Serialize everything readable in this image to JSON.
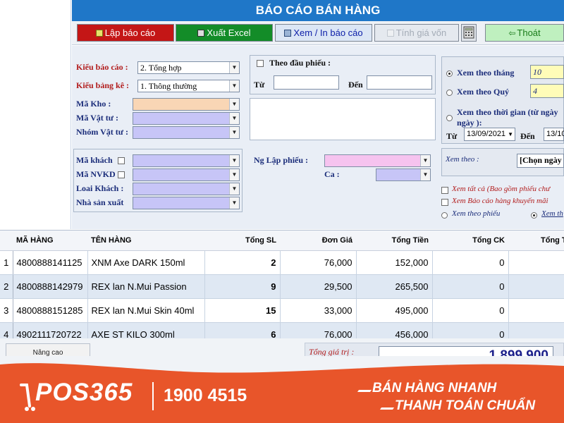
{
  "title": "BÁO CÁO BÁN HÀNG",
  "toolbar": {
    "report": "Lập báo cáo",
    "excel": "Xuất Excel",
    "view_print": "Xem / In báo cáo",
    "cost": "Tính giá vốn",
    "exit": "Thoát"
  },
  "filters": {
    "report_type_label": "Kiểu báo cáo :",
    "report_type_value": "2. Tổng hợp",
    "list_type_label": "Kiểu bảng kê :",
    "list_type_value": "1. Thông thường",
    "warehouse_label": "Mã Kho :",
    "material_label": "Mã Vật tư :",
    "material_group_label": "Nhóm Vật tư :",
    "customer_label": "Mã khách",
    "staff_label": "Mã NVKD",
    "customer_type_label": "Loai Khách :",
    "manufacturer_label": "Nhà sản xuất",
    "voucher_head_label": "Theo đầu phiếu :",
    "from_label": "Từ",
    "to_label": "Đến",
    "creator_label": "Ng Lập phiếu :",
    "shift_label": "Ca :"
  },
  "period": {
    "by_month_label": "Xem theo tháng",
    "month_value": "10",
    "by_quarter_label": "Xem theo Quý",
    "quarter_value": "4",
    "by_time_label": "Xem theo thời gian (từ ngày",
    "by_time_label2": "ngày ):",
    "from_label": "Từ",
    "from_date": "13/09/2021",
    "to_label": "Đến",
    "to_date": "13/10"
  },
  "view_by": {
    "label": "Xem theo :",
    "value": "[Chọn ngày"
  },
  "options": {
    "view_all": "Xem tất cả (Bao gồm phiếu chư",
    "promo": "Xem Báo cáo hàng khuyến mãi",
    "by_voucher": "Xem theo phiếu",
    "by_item": "Xem th"
  },
  "table": {
    "headers": [
      "MÃ HÀNG",
      "TÊN HÀNG",
      "Tổng SL",
      "Đơn Giá",
      "Tổng Tiền",
      "Tổng CK",
      "Tổng T"
    ],
    "rows": [
      {
        "no": "1",
        "code": "4800888141125",
        "name": "XNM Axe DARK 150ml",
        "qty": "2",
        "price": "76,000",
        "total": "152,000",
        "discount": "0"
      },
      {
        "no": "2",
        "code": "4800888142979",
        "name": "REX lan N.Mui Passion",
        "qty": "9",
        "price": "29,500",
        "total": "265,500",
        "discount": "0"
      },
      {
        "no": "3",
        "code": "4800888151285",
        "name": "REX lan N.Mui Skin 40ml",
        "qty": "15",
        "price": "33,000",
        "total": "495,000",
        "discount": "0"
      },
      {
        "no": "4",
        "code": "4902111720722",
        "name": "AXE ST KILO 300ml",
        "qty": "6",
        "price": "76,000",
        "total": "456,000",
        "discount": "0"
      }
    ]
  },
  "footer": {
    "advanced": "Nâng cao",
    "total_label": "Tổng giá trị :",
    "total_value": "1.899.900"
  },
  "banner": {
    "brand": "POS365",
    "hotline": "1900 4515",
    "slogan1": "BÁN HÀNG NHANH",
    "slogan2": "THANH TOÁN CHUẨN"
  },
  "colors": {
    "title_bar": "#1f77c8",
    "report_btn": "#c41616",
    "excel_btn": "#138c28",
    "banner": "#e8552a",
    "total": "#1a1f8a"
  }
}
